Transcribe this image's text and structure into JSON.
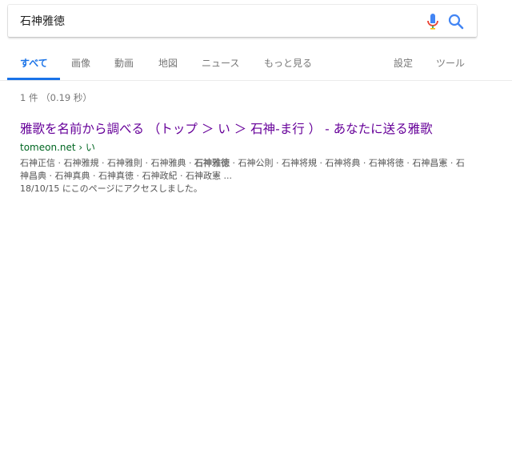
{
  "search": {
    "query": "石神雅徳"
  },
  "tabs": [
    {
      "label": "すべて",
      "active": true
    },
    {
      "label": "画像"
    },
    {
      "label": "動画"
    },
    {
      "label": "地図"
    },
    {
      "label": "ニュース"
    },
    {
      "label": "もっと見る"
    }
  ],
  "tools": {
    "settings": "設定",
    "tools": "ツール"
  },
  "stats": "1 件 （0.19 秒）",
  "result": {
    "title": "雅歌を名前から調べる （トップ ＞ い ＞ 石神-ま行 ） - あなたに送る雅歌",
    "url": "tomeon.net",
    "url_path": " › い",
    "snippet_before": "石神正信 · 石神雅規 · 石神雅則 · 石神雅典 · ",
    "snippet_bold": "石神雅徳",
    "snippet_after": " · 石神公則 · 石神将規 · 石神将典 · 石神将徳 · 石神昌憲 · 石神昌典 · 石神真典 · 石神真徳 · 石神政紀 · 石神政憲 ...",
    "visited": "18/10/15 にこのページにアクセスしました。"
  },
  "colors": {
    "accent": "#1a73e8",
    "visited_link": "#660099",
    "url_green": "#006621"
  }
}
